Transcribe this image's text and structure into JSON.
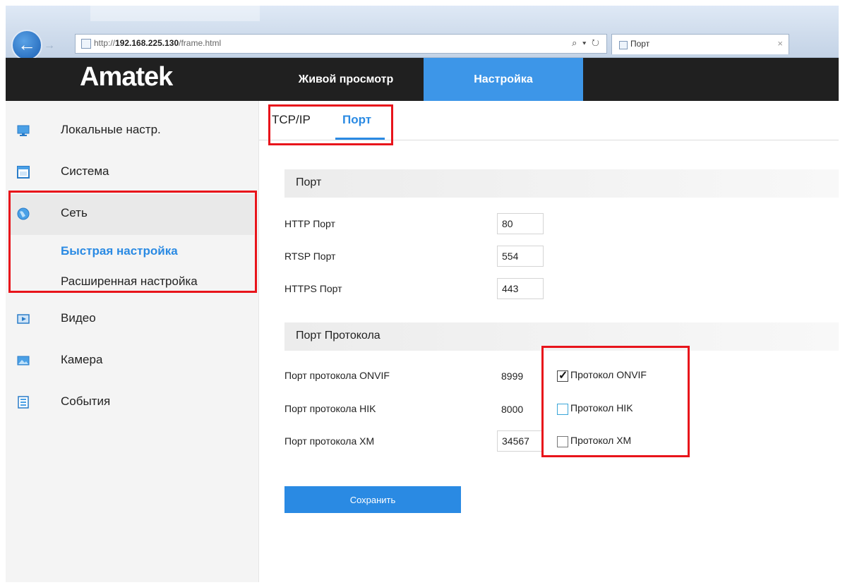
{
  "browser": {
    "url_prefix": "http://",
    "url_host": "192.168.225.130",
    "url_path": "/frame.html",
    "address_tools": "⌕ ▾ ↻",
    "tab_title": "Порт",
    "tab_close": "×",
    "back_icon": "back-arrow-icon",
    "forward_icon": "forward-arrow-icon"
  },
  "app": {
    "logo": "Amatek",
    "nav": [
      {
        "label": "Живой просмотр",
        "active": false
      },
      {
        "label": "Настройка",
        "active": true
      }
    ],
    "accent_color": "#3d96e8"
  },
  "sidebar": {
    "items": [
      {
        "label": "Локальные настр.",
        "icon": "monitor-icon"
      },
      {
        "label": "Система",
        "icon": "window-icon"
      },
      {
        "label": "Сеть",
        "icon": "globe-icon"
      },
      {
        "label": "Видео",
        "icon": "video-icon"
      },
      {
        "label": "Камера",
        "icon": "image-icon"
      },
      {
        "label": "События",
        "icon": "list-icon"
      }
    ],
    "network_sub": [
      {
        "label": "Быстрая настройка",
        "active": true
      },
      {
        "label": "Расширенная настройка",
        "active": false
      }
    ]
  },
  "content": {
    "tabs": [
      {
        "label": "TCP/IP",
        "active": false
      },
      {
        "label": "Порт",
        "active": true
      }
    ],
    "port_section": {
      "title": "Порт",
      "rows": [
        {
          "label": "HTTP Порт",
          "value": "80"
        },
        {
          "label": "RTSP Порт",
          "value": "554"
        },
        {
          "label": "HTTPS Порт",
          "value": "443"
        }
      ]
    },
    "protocol_section": {
      "title": "Порт Протокола",
      "rows": [
        {
          "label": "Порт протокола ONVIF",
          "value": "8999",
          "checkbox_label": "Протокол ONVIF",
          "checked": true
        },
        {
          "label": "Порт протокола HIK",
          "value": "8000",
          "checkbox_label": "Протокол HIK",
          "checked": false
        },
        {
          "label": "Порт протокола XM",
          "value": "34567",
          "checkbox_label": "Протокол XM",
          "checked": false
        }
      ]
    },
    "save_label": "Сохранить"
  },
  "highlight_color": "#e8141b"
}
